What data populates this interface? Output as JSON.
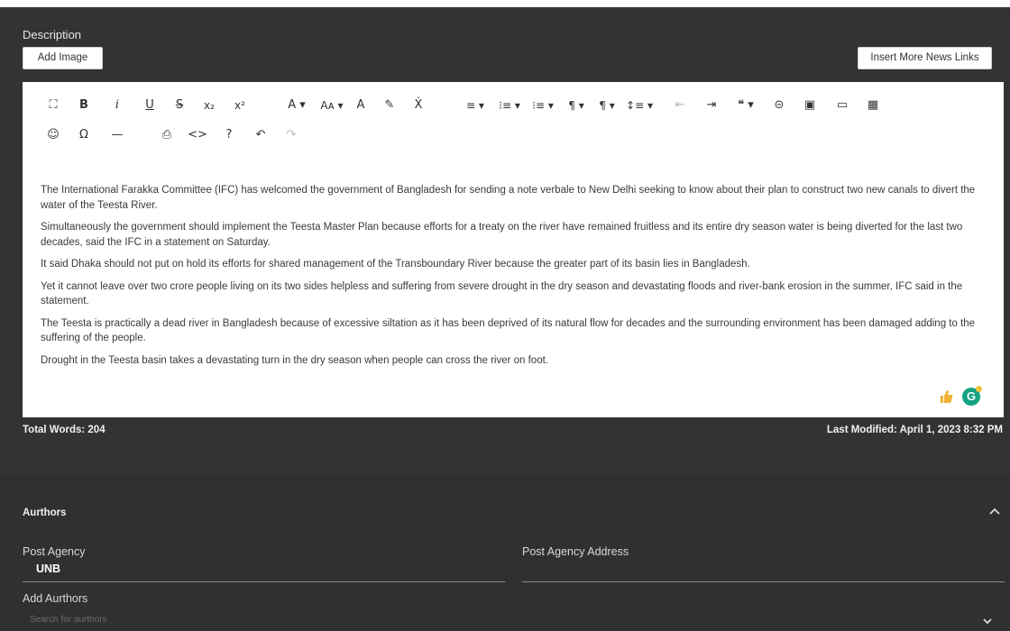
{
  "description": {
    "label": "Description",
    "add_image_label": "Add Image",
    "insert_links_label": "Insert More News Links"
  },
  "toolbar": {
    "row1": [
      "⛶",
      "B",
      "i",
      "U",
      "S",
      "x₂",
      "x²",
      "A ▾",
      "Aᴀ ▾",
      "A",
      "✎",
      "Ẋ",
      "≡ ▾",
      "⁝≡ ▾",
      "⁝≡ ▾",
      "¶ ▾",
      "¶ ▾",
      "↕≡ ▾",
      "⇤",
      "⇥",
      "❝ ▾",
      "⊝",
      "▣",
      "▭",
      "▦"
    ],
    "row2": [
      "☺",
      "Ω",
      "—",
      "⎙",
      "<>",
      "?",
      "↶",
      "↷"
    ]
  },
  "content": {
    "paragraphs": [
      "The International Farakka Committee (IFC) has welcomed the government of Bangladesh for sending a note verbale to New Delhi seeking to know about their plan to construct two new canals to divert the water of the Teesta River.",
      "Simultaneously the government should implement the Teesta Master Plan because efforts for a treaty on the river have remained fruitless and its entire dry season water is being diverted for the last two decades, said the IFC in a statement on Saturday.",
      "It said Dhaka should not put on hold its efforts for shared management of the Transboundary River because the greater part of its basin lies in Bangladesh.",
      "Yet it cannot leave over two crore people living on its two sides helpless and suffering from severe drought in the dry season and devastating floods and river-bank erosion in the summer, IFC said in the statement.",
      "The Teesta is practically a dead river in Bangladesh because of excessive siltation as it has been deprived of its natural flow for decades and the surrounding environment has been damaged adding to the suffering of the people.",
      "Drought in the Teesta basin takes a devastating turn in the dry season when people can cross the river on foot."
    ],
    "grammarly_letter": "G"
  },
  "status": {
    "total_words": "Total Words: 204",
    "last_modified": "Last Modified: April 1, 2023 8:32 PM"
  },
  "authors": {
    "heading": "Aurthors",
    "post_agency_label": "Post Agency",
    "post_agency_value": "UNB",
    "post_agency_address_label": "Post Agency Address",
    "add_authors_label": "Add Aurthors",
    "search_placeholder": "Search for aurthors"
  },
  "icons": {
    "collapse": "chevron-up-icon",
    "dropdown": "chevron-down-icon"
  }
}
